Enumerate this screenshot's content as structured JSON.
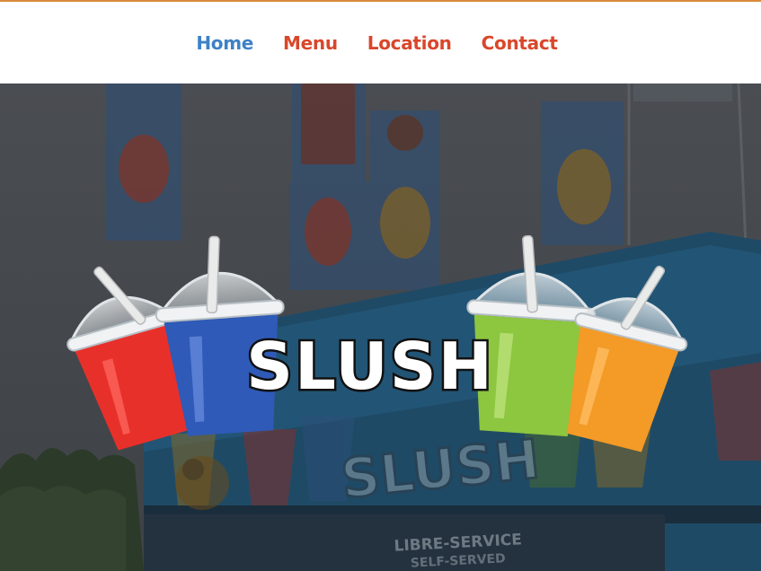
{
  "theme": {
    "accent_line": "#d98a3a",
    "nav_active": "#3d82c6",
    "nav_default": "#d9472b"
  },
  "nav": {
    "items": [
      {
        "label": "Home",
        "active": true
      },
      {
        "label": "Menu",
        "active": false
      },
      {
        "label": "Location",
        "active": false
      },
      {
        "label": "Contact",
        "active": false
      }
    ]
  },
  "hero": {
    "logo_text": "SLUSH",
    "truck_sign": "SLUSH",
    "truck_line1": "LIBRE-SERVICE",
    "truck_line2": "SELF-SERVED",
    "cup_colors": {
      "red": "#e8302b",
      "blue": "#2f5ab8",
      "green": "#8dc63f",
      "orange": "#f39a27"
    }
  }
}
